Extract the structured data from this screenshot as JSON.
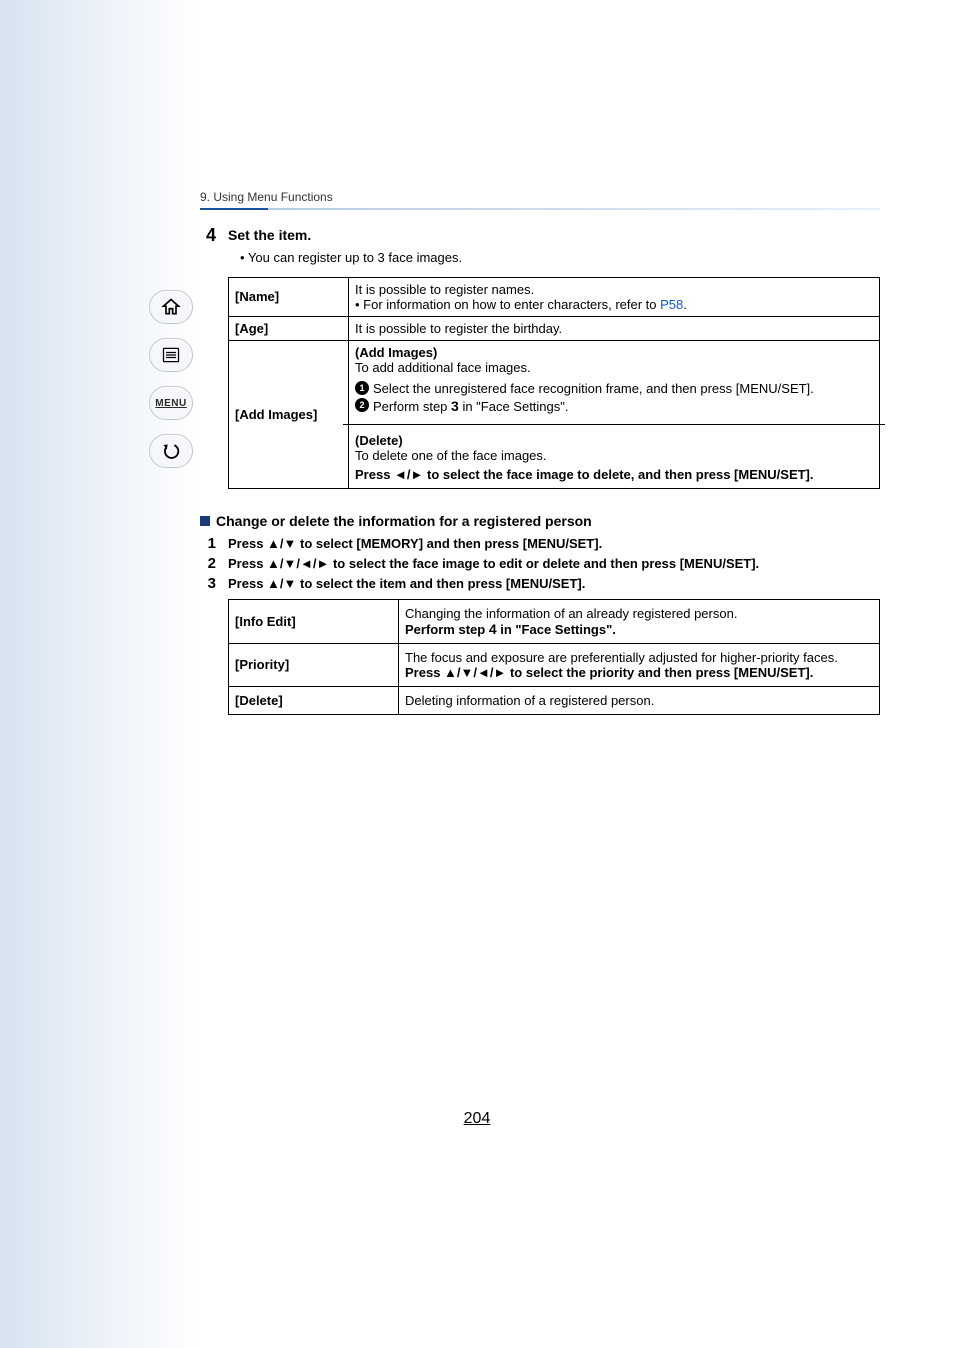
{
  "breadcrumb": "9. Using Menu Functions",
  "step4": {
    "num": "4",
    "title": "Set the item.",
    "sub": "You can register up to 3 face images."
  },
  "table1": {
    "rows": [
      {
        "label": "[Name]",
        "line1": "It is possible to register names.",
        "line2a": "• For information on how to enter characters, refer to ",
        "line2link": "P58",
        "line2b": "."
      },
      {
        "label": "[Age]",
        "line1": "It is possible to register the birthday."
      }
    ],
    "addImages": {
      "label": "[Add Images]",
      "addHead": "(Add Images)",
      "addDesc": "To add additional face images.",
      "s1": "Select the unregistered face recognition frame, and then press [MENU/SET].",
      "s2a": "Perform step ",
      "s2step": "3",
      "s2b": " in \"Face Settings\".",
      "delHead": "(Delete)",
      "delDesc": "To delete one of the face images.",
      "delInstrA": "Press ",
      "delInstrArrows": "◄/►",
      "delInstrB": " to select the face image to delete, and then press [MENU/SET]."
    }
  },
  "section2": {
    "heading": "Change or delete the information for a registered person",
    "items": [
      {
        "num": "1",
        "textA": "Press ",
        "arrows": "▲/▼",
        "textB": " to select [MEMORY] and then press [MENU/SET]."
      },
      {
        "num": "2",
        "textA": "Press ",
        "arrows": "▲/▼/◄/►",
        "textB": " to select the face image to edit or delete and then press [MENU/SET]."
      },
      {
        "num": "3",
        "textA": "Press ",
        "arrows": "▲/▼",
        "textB": " to select the item and then press [MENU/SET]."
      }
    ]
  },
  "table2": {
    "rows": [
      {
        "label": "[Info Edit]",
        "line1": "Changing the information of an already registered person.",
        "boldA": "Perform step ",
        "boldStep": "4",
        "boldB": " in \"Face Settings\"."
      },
      {
        "label": "[Priority]",
        "line1": "The focus and exposure are preferentially adjusted for higher-priority faces.",
        "boldA": "Press ",
        "boldArrows": "▲/▼/◄/►",
        "boldB": " to select the priority and then press [MENU/SET]."
      },
      {
        "label": "[Delete]",
        "line1": "Deleting information of a registered person."
      }
    ]
  },
  "nav": {
    "menuLabel": "MENU"
  },
  "pageNumber": "204"
}
